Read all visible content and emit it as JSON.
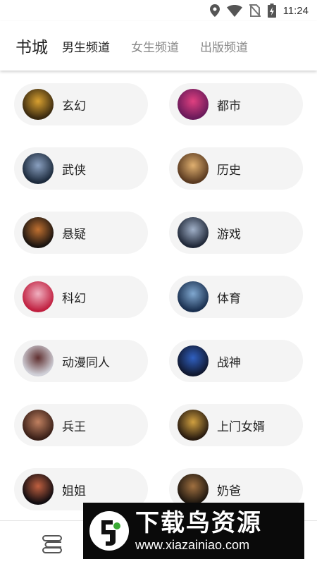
{
  "status_bar": {
    "time": "11:24",
    "icons": [
      "location-icon",
      "wifi-icon",
      "no-sim-icon",
      "battery-charging-icon"
    ]
  },
  "header": {
    "title": "书城",
    "tabs": [
      {
        "label": "男生频道",
        "active": true
      },
      {
        "label": "女生频道",
        "active": false
      },
      {
        "label": "出版频道",
        "active": false
      }
    ]
  },
  "categories": [
    {
      "label": "玄幻",
      "cover_colors": [
        "#3a2a10",
        "#d8a030"
      ]
    },
    {
      "label": "都市",
      "cover_colors": [
        "#6a1a5a",
        "#e04080"
      ]
    },
    {
      "label": "武侠",
      "cover_colors": [
        "#1c2a3c",
        "#8aa0c0"
      ]
    },
    {
      "label": "历史",
      "cover_colors": [
        "#5a3a20",
        "#e0b070"
      ]
    },
    {
      "label": "悬疑",
      "cover_colors": [
        "#1a1410",
        "#c07030"
      ]
    },
    {
      "label": "游戏",
      "cover_colors": [
        "#202838",
        "#a0b0c8"
      ]
    },
    {
      "label": "科幻",
      "cover_colors": [
        "#c02040",
        "#f0b0c0"
      ]
    },
    {
      "label": "体育",
      "cover_colors": [
        "#1a3050",
        "#80a8d0"
      ]
    },
    {
      "label": "动漫同人",
      "cover_colors": [
        "#d0d0d8",
        "#603030"
      ]
    },
    {
      "label": "战神",
      "cover_colors": [
        "#101830",
        "#3060c0"
      ]
    },
    {
      "label": "兵王",
      "cover_colors": [
        "#3a2018",
        "#c08060"
      ]
    },
    {
      "label": "上门女婿",
      "cover_colors": [
        "#2a1c10",
        "#d0a040"
      ]
    },
    {
      "label": "姐姐",
      "cover_colors": [
        "#100c10",
        "#c06040"
      ]
    },
    {
      "label": "奶爸",
      "cover_colors": [
        "#201810",
        "#a07040"
      ]
    }
  ],
  "bottom_nav": {
    "icon": "bookshelf-icon"
  },
  "watermark": {
    "title": "下载鸟资源",
    "url": "www.xiazainiao.com",
    "logo_icon": "bird-logo-icon"
  }
}
